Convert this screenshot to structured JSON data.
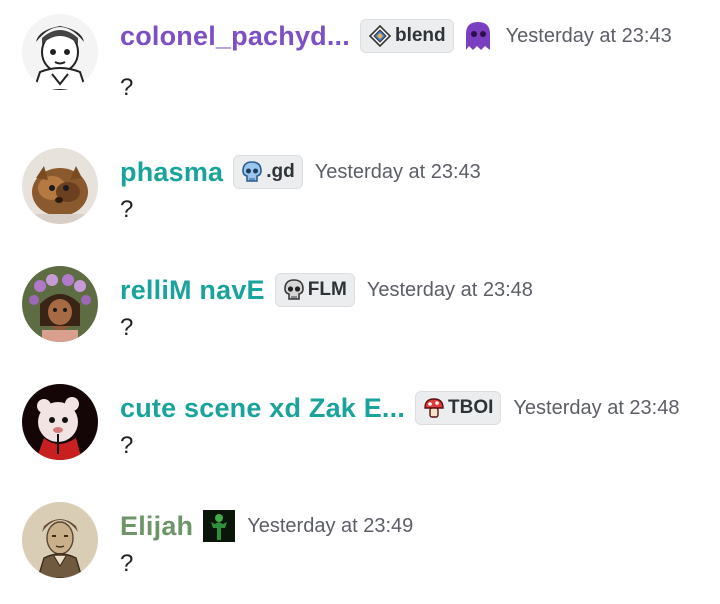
{
  "messages": [
    {
      "username": "colonel_pachyd...",
      "username_color": "#7d4fc4",
      "tag": "blend",
      "tag_icon": "blend-diamond-icon",
      "role_icon": "purple-ghost-icon",
      "timestamp": "Yesterday at 23:43",
      "content": "?"
    },
    {
      "username": "phasma",
      "username_color": "#19a39b",
      "tag": ".gd",
      "tag_icon": "blue-skull-icon",
      "timestamp": "Yesterday at 23:43",
      "content": "?"
    },
    {
      "username": "relliM navE",
      "username_color": "#19a39b",
      "tag": "FLM",
      "tag_icon": "grey-skull-icon",
      "timestamp": "Yesterday at 23:48",
      "content": "?"
    },
    {
      "username": "cute scene xd Zak E...",
      "username_color": "#19a39b",
      "tag": "TBOI",
      "tag_icon": "red-mushroom-icon",
      "timestamp": "Yesterday at 23:48",
      "content": "?"
    },
    {
      "username": "Elijah",
      "username_color": "#6e9569",
      "role_icon": "green-figure-icon",
      "timestamp": "Yesterday at 23:49",
      "content": "?"
    }
  ]
}
